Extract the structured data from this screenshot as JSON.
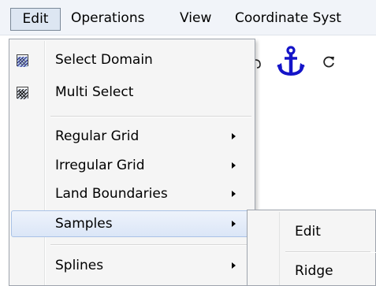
{
  "menubar": {
    "items": [
      {
        "label": "Edit"
      },
      {
        "label": "Operations"
      },
      {
        "label": "View"
      },
      {
        "label": "Coordinate Syst"
      }
    ]
  },
  "edit_menu": {
    "items": [
      {
        "label": "Select Domain",
        "icon": "select-domain-icon"
      },
      {
        "label": "Multi Select",
        "icon": "multi-select-icon"
      },
      {
        "label": "Regular Grid",
        "submenu": true
      },
      {
        "label": "Irregular Grid",
        "submenu": true
      },
      {
        "label": "Land Boundaries",
        "submenu": true
      },
      {
        "label": "Samples",
        "submenu": true,
        "highlighted": true
      },
      {
        "label": "Splines",
        "submenu": true
      }
    ]
  },
  "samples_submenu": {
    "items": [
      {
        "label": "Edit"
      },
      {
        "label": "Ridge"
      }
    ]
  },
  "toolbar": {
    "icons": [
      "anchor-icon",
      "refresh-icon"
    ]
  },
  "colors": {
    "anchor": "#1414c8",
    "menu_bg": "#f5f5f5",
    "highlight_border": "#a9c2e6"
  }
}
